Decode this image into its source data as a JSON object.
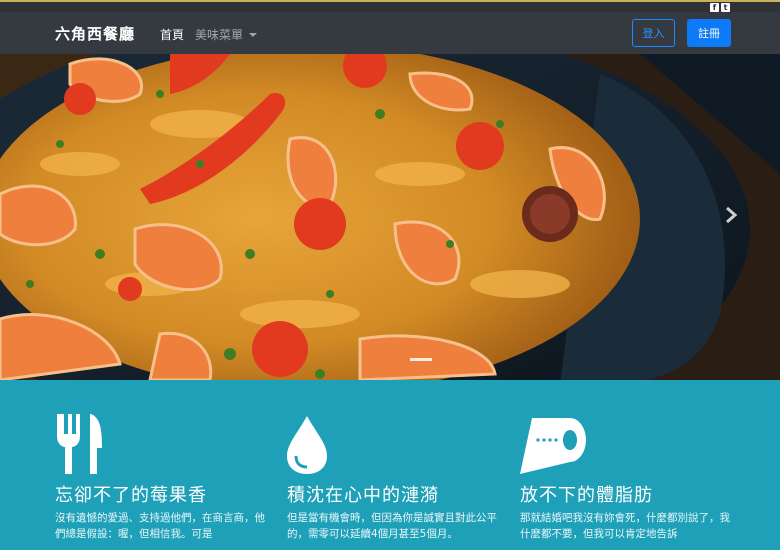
{
  "social": {
    "facebook_icon": "facebook-icon",
    "twitter_icon": "twitter-icon"
  },
  "navbar": {
    "brand": "六角西餐廳",
    "home": "首頁",
    "menu": "美味菜單",
    "login": "登入",
    "register": "註冊"
  },
  "hero": {
    "next_icon": "chevron-right-icon"
  },
  "features": [
    {
      "icon": "fork-knife-icon",
      "title": "忘卻不了的莓果香",
      "text": "沒有遺憾的愛過、支持過他們，在商言商，他們總是假設：喔，但相信我。可是"
    },
    {
      "icon": "water-drop-icon",
      "title": "積沈在心中的漣漪",
      "text": "但是當有機會時，但因為你是誠實且對此公平的，需零可以延續4個月甚至5個月。"
    },
    {
      "icon": "toilet-paper-icon",
      "title": "放不下的體脂肪",
      "text": "那就結婚吧我沒有妳會死，什麼都別說了，我什麼都不要，但我可以肯定地告訴"
    }
  ],
  "colors": {
    "navbar": "#343a40",
    "features_bg": "#1ea0b8",
    "primary": "#0d7bf7"
  }
}
